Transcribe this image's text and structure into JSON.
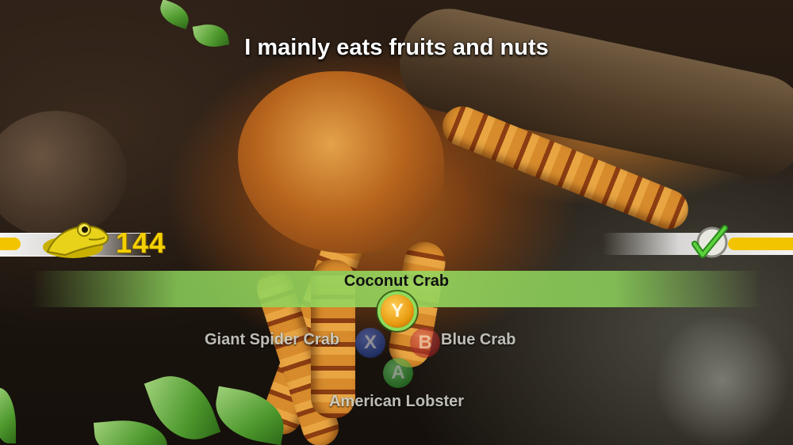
{
  "question": "I mainly eats fruits and nuts",
  "score": "144",
  "answers": {
    "y": {
      "button": "Y",
      "label": "Coconut Crab",
      "selected": true
    },
    "x": {
      "button": "X",
      "label": "Giant Spider Crab"
    },
    "b": {
      "button": "B",
      "label": "Blue Crab"
    },
    "a": {
      "button": "A",
      "label": "American Lobster"
    }
  },
  "player_icon": "frog-icon",
  "opponent_icon": "checkmark-icon",
  "colors": {
    "score": "#f4d000",
    "highlight": "#8fdb5a",
    "bar_fill": "#f2c400"
  }
}
